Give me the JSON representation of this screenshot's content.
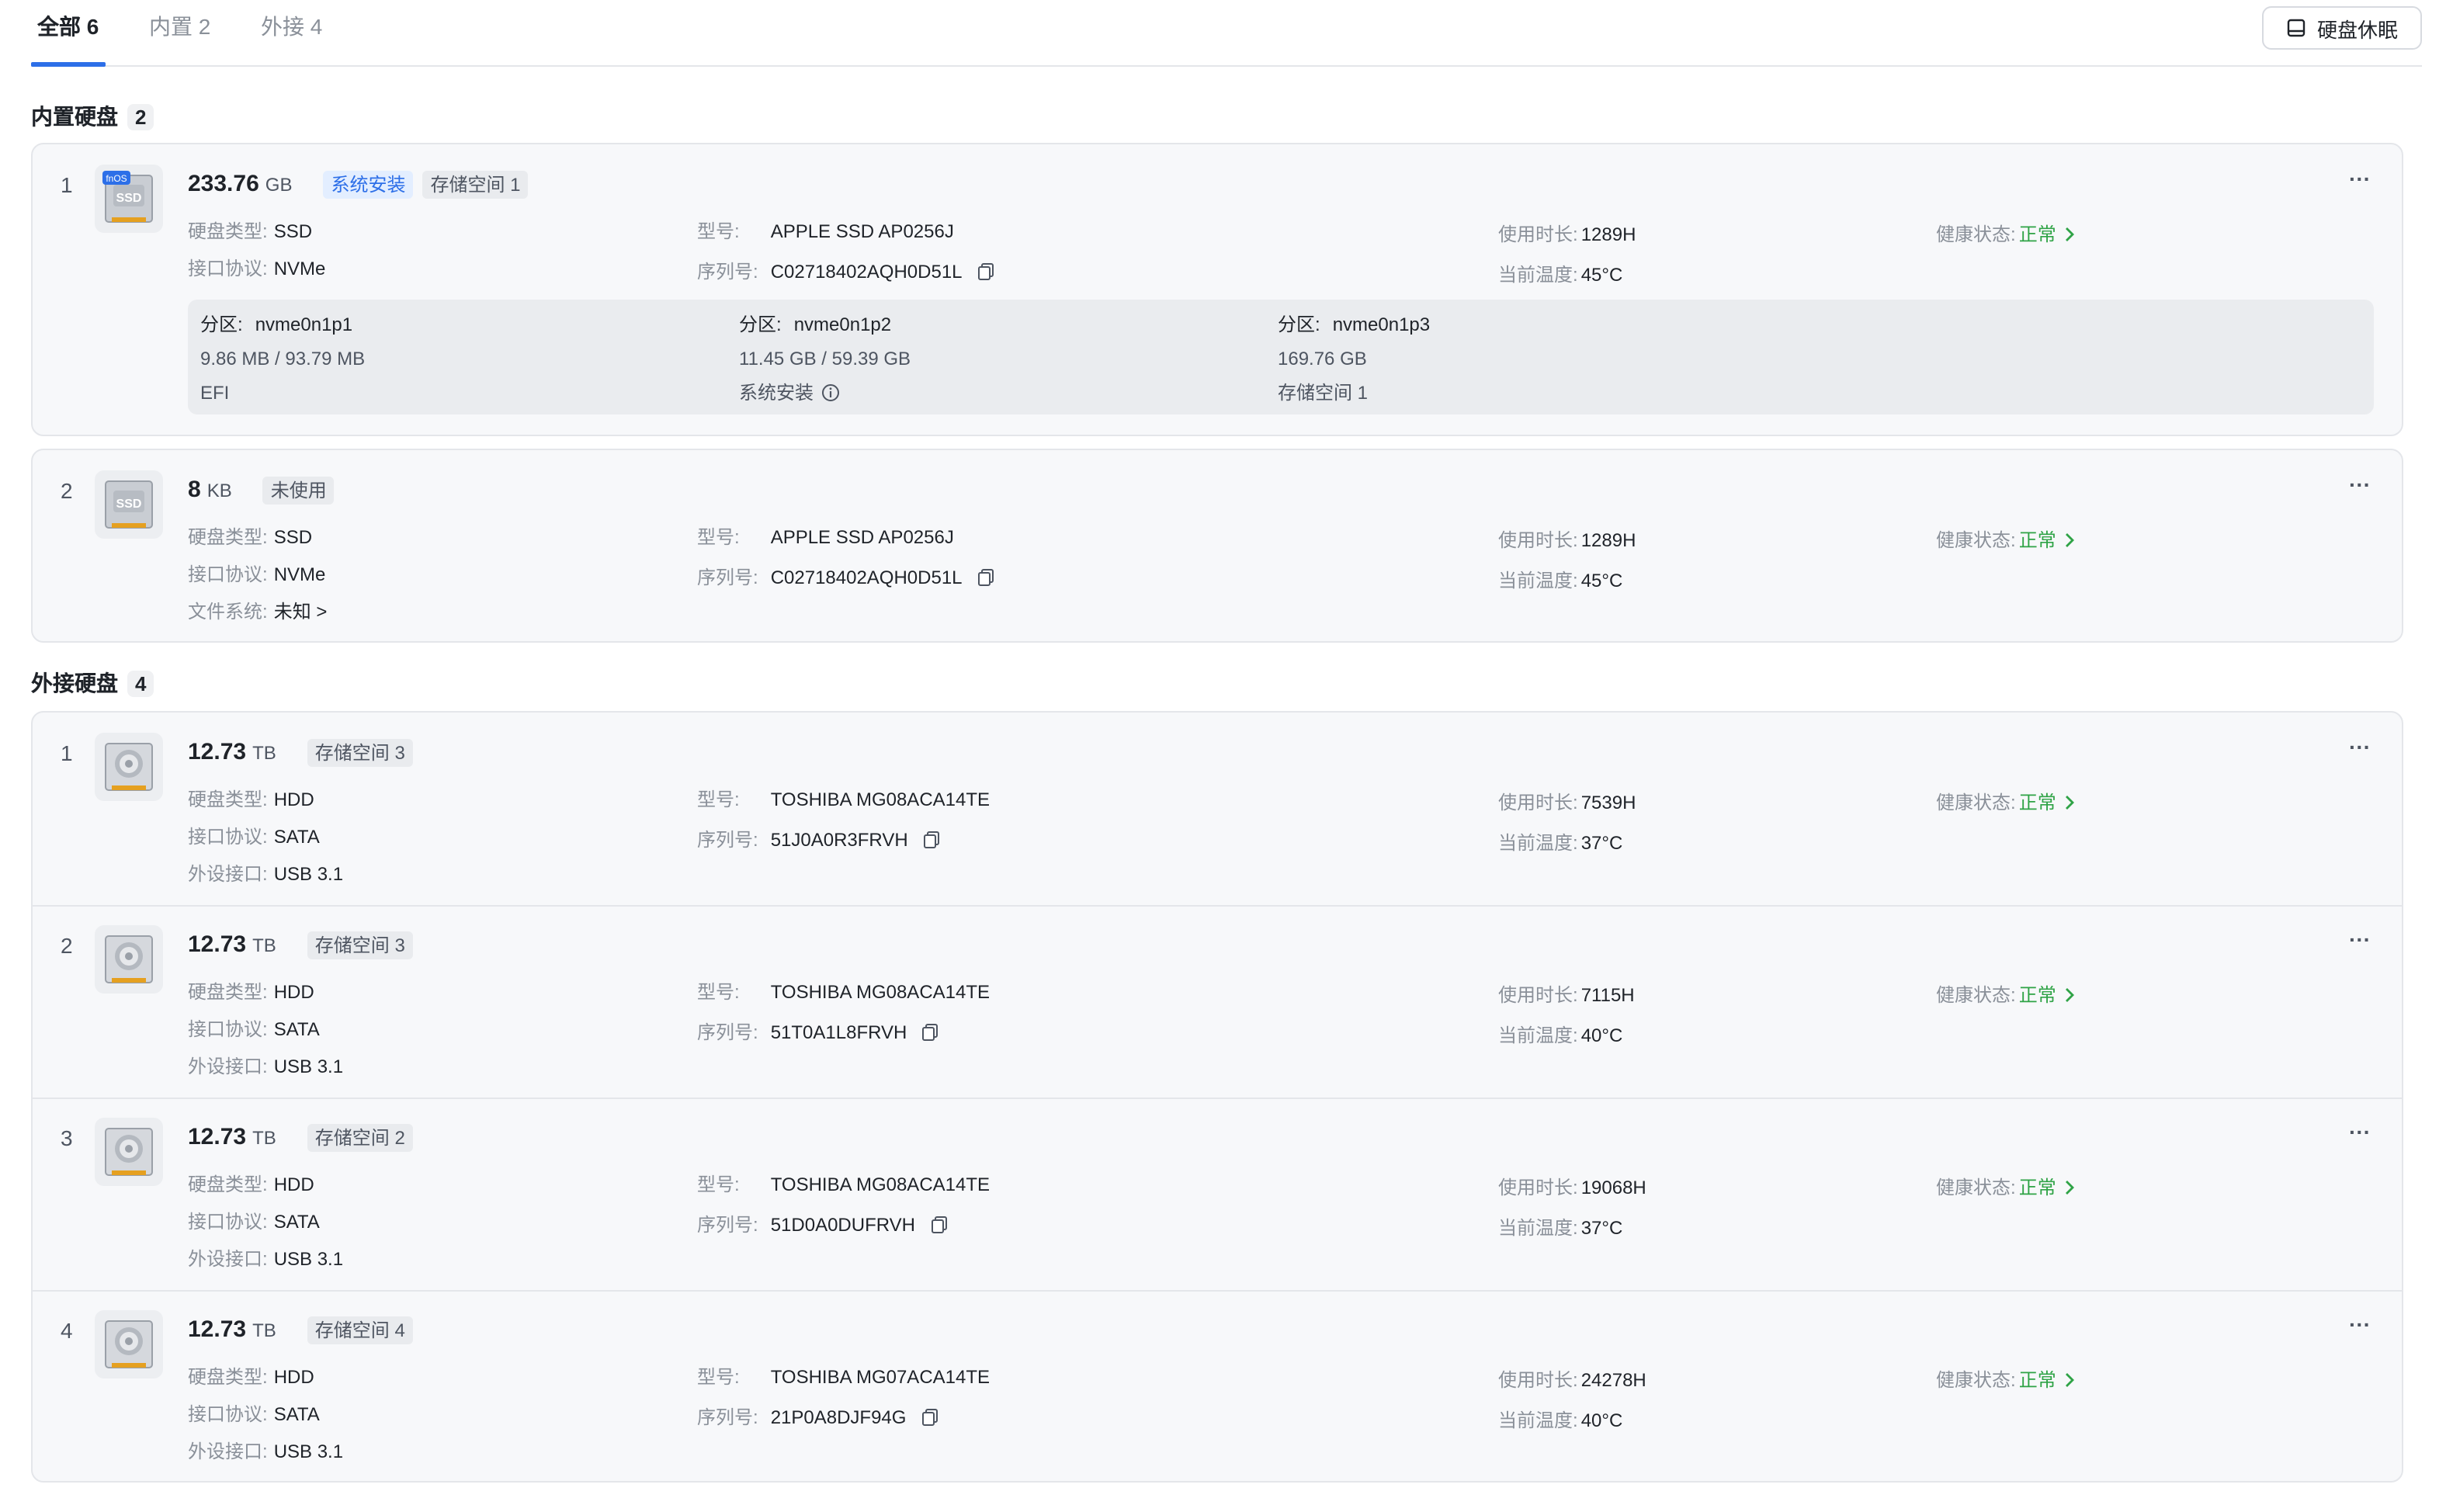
{
  "tabs": [
    {
      "label": "全部 6"
    },
    {
      "label": "内置 2"
    },
    {
      "label": "外接 4"
    }
  ],
  "sleep_button": {
    "label": "硬盘休眠",
    "icon": "disk-sleep-icon"
  },
  "internal_section": {
    "title": "内置硬盘",
    "count": "2"
  },
  "external_section": {
    "title": "外接硬盘",
    "count": "4"
  },
  "labels": {
    "disk_type": "硬盘类型:",
    "protocol": "接口协议:",
    "filesystem": "文件系统:",
    "ext_port": "外设接口:",
    "model": "型号:",
    "serial": "序列号:",
    "usage": "使用时长:",
    "temp": "当前温度:",
    "health": "健康状态:",
    "partition": "分区:"
  },
  "internal_disks": [
    {
      "index": "1",
      "icon": "ssd-fnos-icon",
      "cap": "233.76",
      "unit": "GB",
      "tags": [
        "系统安装",
        "存储空间 1"
      ],
      "type": "SSD",
      "protocol": "NVMe",
      "model": "APPLE SSD AP0256J",
      "serial": "C02718402AQH0D51L",
      "usage": "1289H",
      "temp": "45°C",
      "health": "正常",
      "partitions": [
        {
          "name": "nvme0n1p1",
          "size": "9.86 MB / 93.79 MB",
          "label": "EFI"
        },
        {
          "name": "nvme0n1p2",
          "size": "11.45 GB / 59.39 GB",
          "label": "系统安装"
        },
        {
          "name": "nvme0n1p3",
          "size": "169.76 GB",
          "label": "存储空间 1"
        }
      ]
    },
    {
      "index": "2",
      "icon": "ssd-icon",
      "cap": "8",
      "unit": "KB",
      "tags": [
        "未使用"
      ],
      "type": "SSD",
      "protocol": "NVMe",
      "filesystem": "未知 >",
      "model": "APPLE SSD AP0256J",
      "serial": "C02718402AQH0D51L",
      "usage": "1289H",
      "temp": "45°C",
      "health": "正常"
    }
  ],
  "external_disks": [
    {
      "index": "1",
      "icon": "hdd-icon",
      "cap": "12.73",
      "unit": "TB",
      "tag": "存储空间 3",
      "type": "HDD",
      "protocol": "SATA",
      "port": "USB 3.1",
      "model": "TOSHIBA MG08ACA14TE",
      "serial": "51J0A0R3FRVH",
      "usage": "7539H",
      "temp": "37°C",
      "health": "正常"
    },
    {
      "index": "2",
      "icon": "hdd-icon",
      "cap": "12.73",
      "unit": "TB",
      "tag": "存储空间 3",
      "type": "HDD",
      "protocol": "SATA",
      "port": "USB 3.1",
      "model": "TOSHIBA MG08ACA14TE",
      "serial": "51T0A1L8FRVH",
      "usage": "7115H",
      "temp": "40°C",
      "health": "正常"
    },
    {
      "index": "3",
      "icon": "hdd-icon",
      "cap": "12.73",
      "unit": "TB",
      "tag": "存储空间 2",
      "type": "HDD",
      "protocol": "SATA",
      "port": "USB 3.1",
      "model": "TOSHIBA MG08ACA14TE",
      "serial": "51D0A0DUFRVH",
      "usage": "19068H",
      "temp": "37°C",
      "health": "正常"
    },
    {
      "index": "4",
      "icon": "hdd-icon",
      "cap": "12.73",
      "unit": "TB",
      "tag": "存储空间 4",
      "type": "HDD",
      "protocol": "SATA",
      "port": "USB 3.1",
      "model": "TOSHIBA MG07ACA14TE",
      "serial": "21P0A8DJF94G",
      "usage": "24278H",
      "temp": "40°C",
      "health": "正常"
    }
  ],
  "more_glyph": "···",
  "fnos_badge": "fnOS",
  "ssd_label": "SSD"
}
